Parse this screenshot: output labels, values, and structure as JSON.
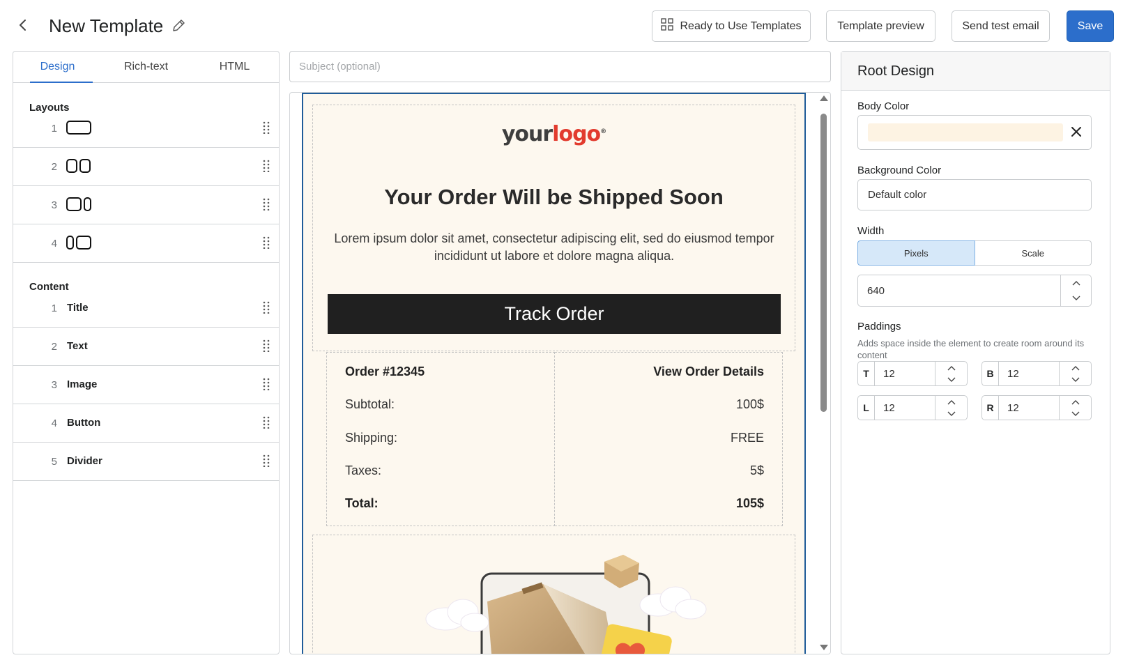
{
  "header": {
    "title": "New Template",
    "buttons": {
      "templates": "Ready to Use Templates",
      "preview": "Template preview",
      "test_email": "Send test email",
      "save": "Save"
    }
  },
  "left_panel": {
    "tabs": [
      "Design",
      "Rich-text",
      "HTML"
    ],
    "active_tab": "Design",
    "layouts_title": "Layouts",
    "layouts": [
      {
        "num": "1",
        "icon": "one-column-layout-icon"
      },
      {
        "num": "2",
        "icon": "two-column-layout-icon"
      },
      {
        "num": "3",
        "icon": "wide-narrow-layout-icon"
      },
      {
        "num": "4",
        "icon": "narrow-wide-layout-icon"
      }
    ],
    "content_title": "Content",
    "content": [
      {
        "num": "1",
        "label": "Title"
      },
      {
        "num": "2",
        "label": "Text"
      },
      {
        "num": "3",
        "label": "Image"
      },
      {
        "num": "4",
        "label": "Button"
      },
      {
        "num": "5",
        "label": "Divider"
      }
    ]
  },
  "editor": {
    "subject_placeholder": "Subject (optional)",
    "logo": {
      "part1": "your",
      "part2": "logo",
      "mark": "®"
    },
    "headline": "Your Order Will be Shipped Soon",
    "body": "Lorem ipsum dolor sit amet, consectetur adipiscing elit, sed do eiusmod tempor incididunt ut labore et dolore magna aliqua.",
    "button": "Track Order",
    "order": {
      "number": "Order #12345",
      "details_link": "View Order Details",
      "rows": [
        {
          "label": "Subtotal:",
          "value": "100$"
        },
        {
          "label": "Shipping:",
          "value": "FREE"
        },
        {
          "label": "Taxes:",
          "value": "5$"
        },
        {
          "label": "Total:",
          "value": "105$"
        }
      ]
    }
  },
  "right_panel": {
    "title": "Root Design",
    "body_color_label": "Body Color",
    "body_color_value": "#fdf3e3",
    "background_color_label": "Background Color",
    "background_color_value": "Default color",
    "width_label": "Width",
    "width_modes": [
      "Pixels",
      "Scale"
    ],
    "width_mode_selected": "Pixels",
    "width_value": "640",
    "paddings_label": "Paddings",
    "paddings_help": "Adds space inside the element to create room around its content",
    "paddings": {
      "T": "12",
      "B": "12",
      "L": "12",
      "R": "12"
    }
  },
  "colors": {
    "accent": "#2c6ecb",
    "email_background": "#fdf8ef",
    "button_dark": "#202020",
    "logo_red": "#e23b2e"
  }
}
